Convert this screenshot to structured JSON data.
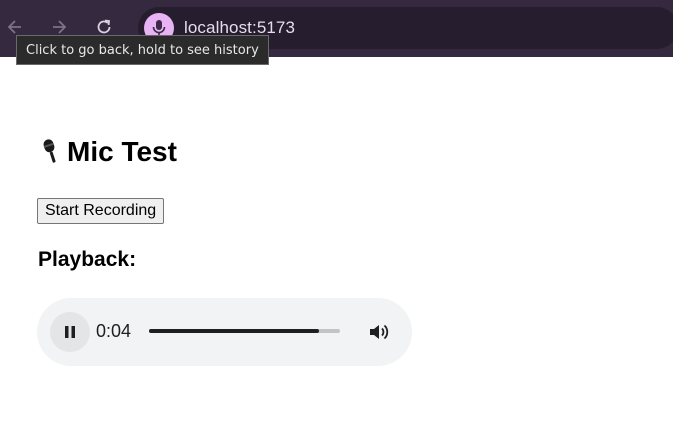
{
  "browser": {
    "url": "localhost:5173",
    "tooltip": "Click to go back, hold to see history",
    "icons": {
      "back": "arrow-left-icon",
      "forward": "arrow-right-icon",
      "reload": "reload-icon",
      "mic": "microphone-icon"
    },
    "colors": {
      "toolbar": "#35293f",
      "mic_chip": "#e8b3f5"
    }
  },
  "page": {
    "title_icon": "microphone-icon",
    "title": "Mic Test",
    "start_button": "Start Recording",
    "playback_heading": "Playback:"
  },
  "player": {
    "time": "0:04",
    "progress_fraction": 0.89,
    "state": "playing",
    "icons": {
      "pause": "pause-icon",
      "volume": "volume-icon"
    }
  }
}
